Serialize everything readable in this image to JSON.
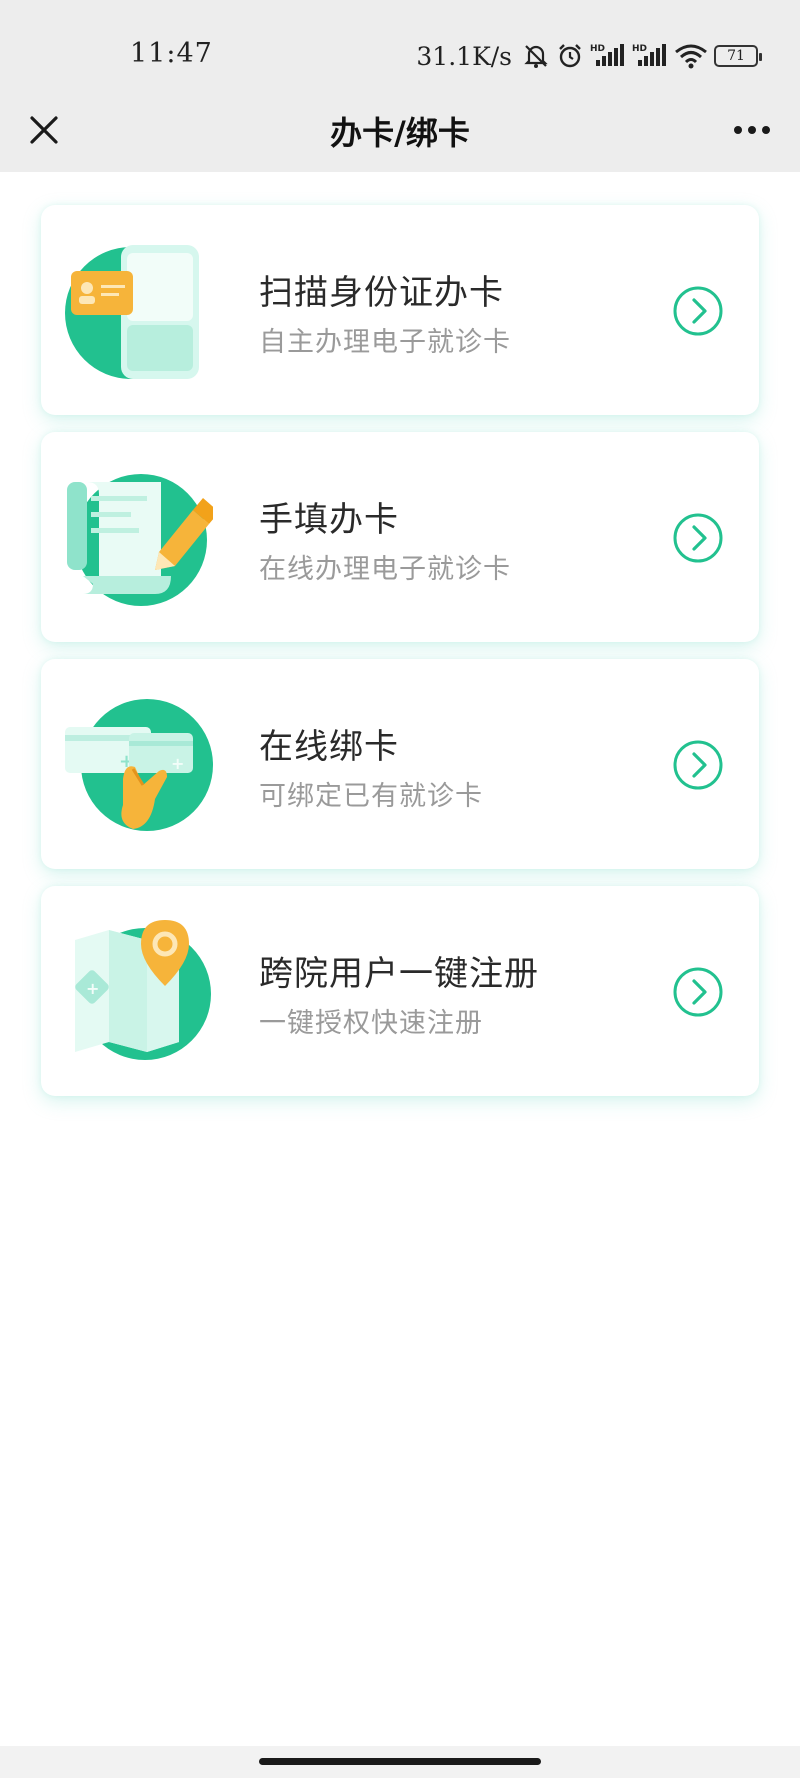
{
  "status_bar": {
    "time": "11:47",
    "speed": "31.1K/s",
    "battery": "71",
    "icons": [
      "bell-muted-icon",
      "alarm-icon",
      "hd-signal-icon",
      "hd-signal-icon",
      "wifi-icon",
      "battery-icon"
    ]
  },
  "nav": {
    "title": "办卡/绑卡",
    "close_icon": "close-icon",
    "more_icon": "more-icon"
  },
  "colors": {
    "accent": "#22c18f",
    "accent_light": "#bdf2e3",
    "orange": "#f6b43a"
  },
  "cards": [
    {
      "title": "扫描身份证办卡",
      "subtitle": "自主办理电子就诊卡",
      "icon": "id-card-scan-illustration"
    },
    {
      "title": "手填办卡",
      "subtitle": "在线办理电子就诊卡",
      "icon": "form-pencil-illustration"
    },
    {
      "title": "在线绑卡",
      "subtitle": "可绑定已有就诊卡",
      "icon": "card-tap-illustration"
    },
    {
      "title": "跨院用户一键注册",
      "subtitle": "一键授权快速注册",
      "icon": "map-pin-illustration"
    }
  ]
}
